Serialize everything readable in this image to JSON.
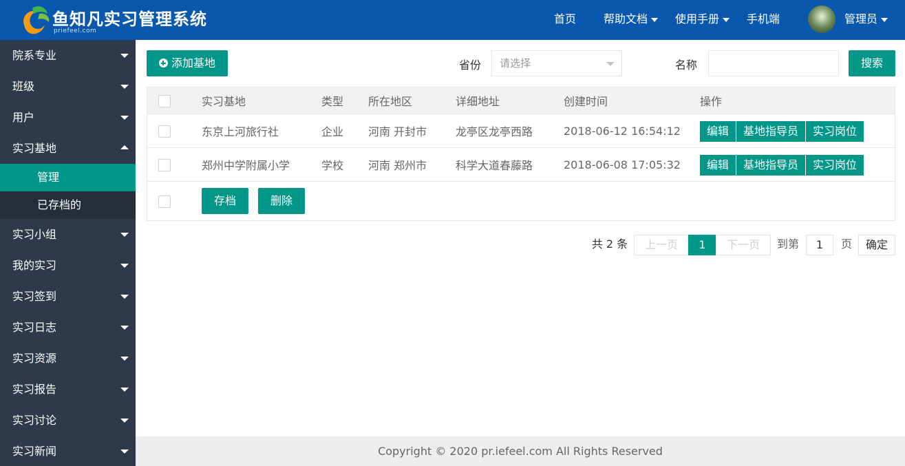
{
  "header": {
    "title": "鱼知凡实习管理系统",
    "subtitle": "priefeel.com",
    "nav": {
      "home": "首页",
      "help_docs": "帮助文档",
      "manual": "使用手册",
      "mobile": "手机端",
      "user": "管理员"
    }
  },
  "sidebar": {
    "items": [
      {
        "label": "院系专业"
      },
      {
        "label": "班级"
      },
      {
        "label": "用户"
      },
      {
        "label": "实习基地"
      },
      {
        "label": "实习小组"
      },
      {
        "label": "我的实习"
      },
      {
        "label": "实习签到"
      },
      {
        "label": "实习日志"
      },
      {
        "label": "实习资源"
      },
      {
        "label": "实习报告"
      },
      {
        "label": "实习讨论"
      },
      {
        "label": "实习新闻"
      }
    ],
    "subitems": [
      {
        "label": "管理"
      },
      {
        "label": "已存档的"
      }
    ]
  },
  "toolbar": {
    "add_label": "添加基地",
    "province_label": "省份",
    "province_placeholder": "请选择",
    "name_label": "名称",
    "name_value": "",
    "search_label": "搜索"
  },
  "table": {
    "headers": [
      "实习基地",
      "类型",
      "所在地区",
      "详细地址",
      "创建时间",
      "操作"
    ],
    "rows": [
      {
        "name": "东京上河旅行社",
        "type": "企业",
        "region": "河南 开封市",
        "address": "龙亭区龙亭西路",
        "created": "2018-06-12 16:54:12"
      },
      {
        "name": "郑州中学附属小学",
        "type": "学校",
        "region": "河南 郑州市",
        "address": "科学大道春藤路",
        "created": "2018-06-08 17:05:32"
      }
    ],
    "actions": {
      "edit": "编辑",
      "instructor": "基地指导员",
      "positions": "实习岗位"
    },
    "archive_label": "存档",
    "delete_label": "删除"
  },
  "pagination": {
    "total": "共 2 条",
    "prev": "上一页",
    "current": "1",
    "next": "下一页",
    "goto": "到第",
    "page_value": "1",
    "page_unit": "页",
    "confirm": "确定"
  },
  "footer": {
    "copyright": "Copyright © 2020 pr.iefeel.com All Rights Reserved"
  },
  "colors": {
    "header_bg": "#0a58ad",
    "sidebar_bg": "#2e3a4a",
    "accent": "#009688"
  }
}
